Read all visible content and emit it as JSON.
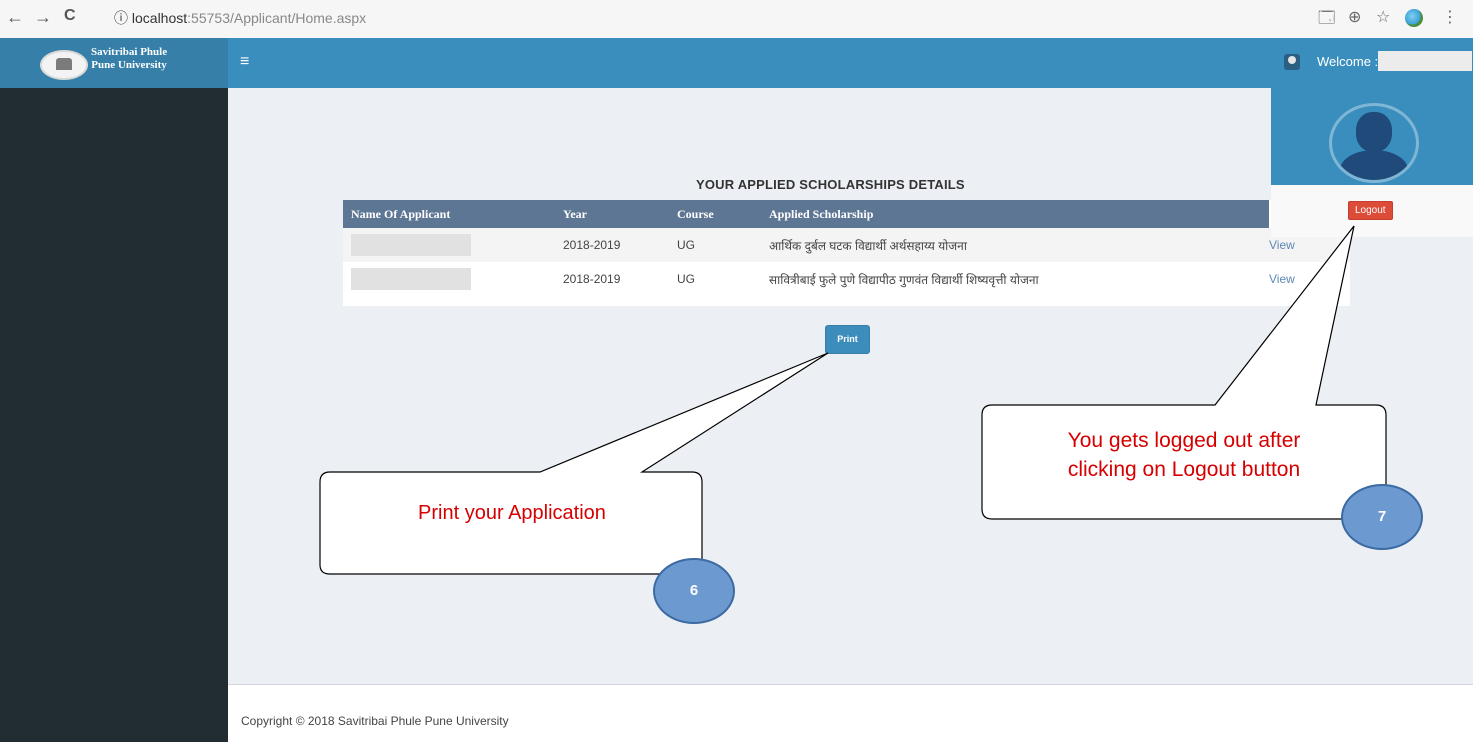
{
  "browser": {
    "back_glyph": "←",
    "forward_glyph": "→",
    "reload_glyph": "C",
    "info_glyph": "ⓘ",
    "url_host": "localhost",
    "url_path": ":55753/Applicant/Home.aspx",
    "translate_glyph": "🗔",
    "zoom_glyph": "⊕",
    "star_glyph": "☆",
    "menu_glyph": "⋮"
  },
  "header": {
    "brand_line1": "Savitribai Phule",
    "brand_line2": "Pune University",
    "menu_glyph": "≡",
    "welcome_label": "Welcome :"
  },
  "user_panel": {
    "logout_label": "Logout"
  },
  "main": {
    "title": "YOUR APPLIED SCHOLARSHIPS DETAILS",
    "columns": [
      "Name Of Applicant",
      "Year",
      "Course",
      "Applied Scholarship"
    ],
    "rows": [
      {
        "year": "2018-2019",
        "course": "UG",
        "scholarship": "आर्थिक दुर्बल घटक विद्यार्थी अर्थसहाय्य योजना",
        "action": "View"
      },
      {
        "year": "2018-2019",
        "course": "UG",
        "scholarship": "सावित्रीबाई फुले पुणे विद्यापीठ गुणवंत विद्यार्थी शिष्यवृत्ती योजना",
        "action": "View"
      }
    ],
    "print_label": "Print"
  },
  "footer": {
    "copyright": "Copyright ©  2018   Savitribai Phule Pune University"
  },
  "callouts": {
    "print_text": "Print your Application",
    "print_badge": "6",
    "logout_text_line1": "You gets logged out after",
    "logout_text_line2": "clicking on Logout button",
    "logout_badge": "7"
  },
  "colors": {
    "header_blue": "#3a8ebd",
    "sidebar_dark": "#222d32",
    "content_bg": "#ecf0f5",
    "table_header": "#5d7694",
    "logout_red": "#dd4b39",
    "callout_red": "#d60000",
    "badge_blue": "#6b99d0"
  }
}
